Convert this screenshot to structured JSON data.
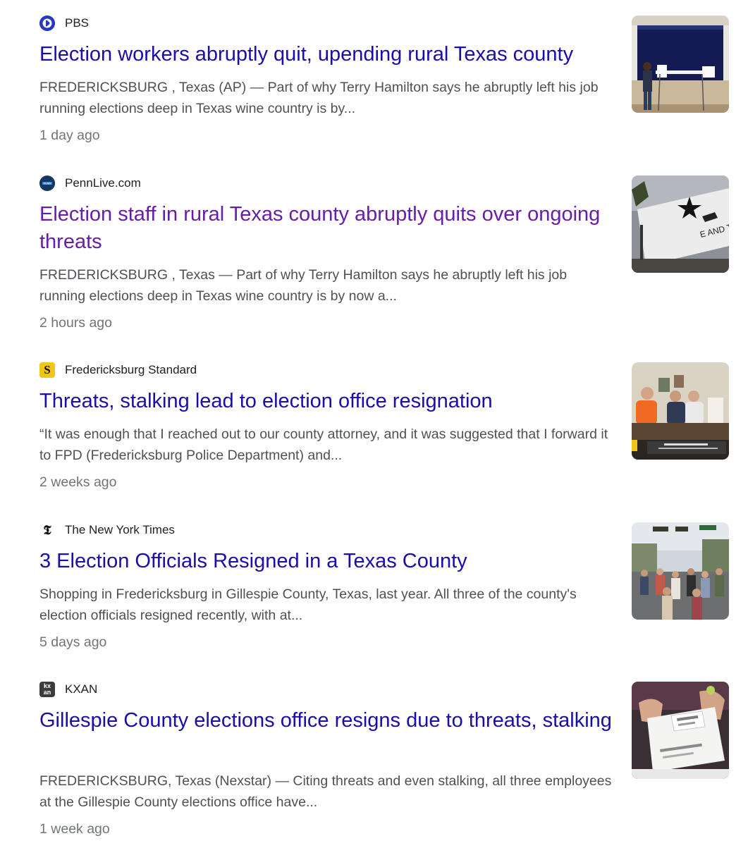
{
  "results": [
    {
      "source": "PBS",
      "source_icon": "pbs-logo-icon",
      "title": "Election workers abruptly quit, upending rural Texas county",
      "snippet": "FREDERICKSBURG , Texas (AP) — Part of why Terry Hamilton says he abruptly left his job running elections deep in Texas wine country is by...",
      "time": "1 day ago",
      "thumbnail": "polling-station-photo",
      "visited": false
    },
    {
      "source": "PennLive.com",
      "source_icon": "pennlive-logo-icon",
      "title": "Election staff in rural Texas county abruptly quits over ongoing threats",
      "snippet": "FREDERICKSBURG , Texas — Part of why Terry Hamilton says he abruptly left his job running elections deep in Texas wine country is by now a...",
      "time": "2 hours ago",
      "thumbnail": "come-and-take-it-flag-photo",
      "visited": true
    },
    {
      "source": "Fredericksburg Standard",
      "source_icon": "fredericksburg-standard-logo-icon",
      "title": "Threats, stalking lead to election office resignation",
      "snippet": "“It was enough that I reached out to our county attorney, and it was suggested that I forward it to FPD (Fredericksburg Police Department) and...",
      "time": "2 weeks ago",
      "thumbnail": "meeting-photo",
      "visited": false
    },
    {
      "source": "The New York Times",
      "source_icon": "nyt-logo-icon",
      "title": "3 Election Officials Resigned in a Texas County",
      "snippet": "Shopping in Fredericksburg in Gillespie County, Texas, last year. All three of the county's election officials resigned recently, with at...",
      "time": "5 days ago",
      "thumbnail": "street-crowd-photo",
      "visited": false
    },
    {
      "source": "KXAN",
      "source_icon": "kxan-logo-icon",
      "title": "Gillespie County elections office resigns due to threats, stalking",
      "snippet": "FREDERICKSBURG, Texas (Nexstar) — Citing threats and even stalking, all three employees at the Gillespie County elections office have...",
      "time": "1 week ago",
      "thumbnail": "mail-ballot-photo",
      "visited": false
    }
  ],
  "icon_glyphs": {
    "fredericksburg_standard": "S",
    "nyt": "𝕿",
    "kxan_top": "kx",
    "kxan_bottom": "an"
  },
  "colors": {
    "title": "#1a0dab",
    "visited_title": "#681da8",
    "snippet": "#4d5156",
    "time": "#70757a",
    "source": "#202124"
  }
}
